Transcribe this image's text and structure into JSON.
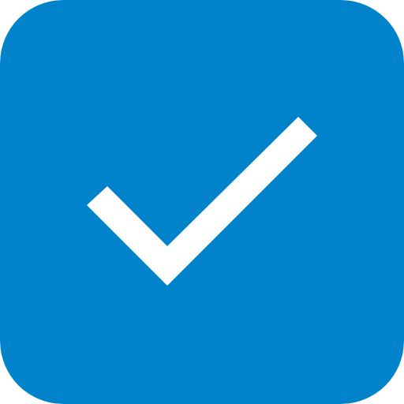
{
  "checkbox": {
    "checked": true,
    "icon": "checkmark-icon",
    "colors": {
      "fill": "#0083CB",
      "check": "#FFFFFF"
    }
  }
}
